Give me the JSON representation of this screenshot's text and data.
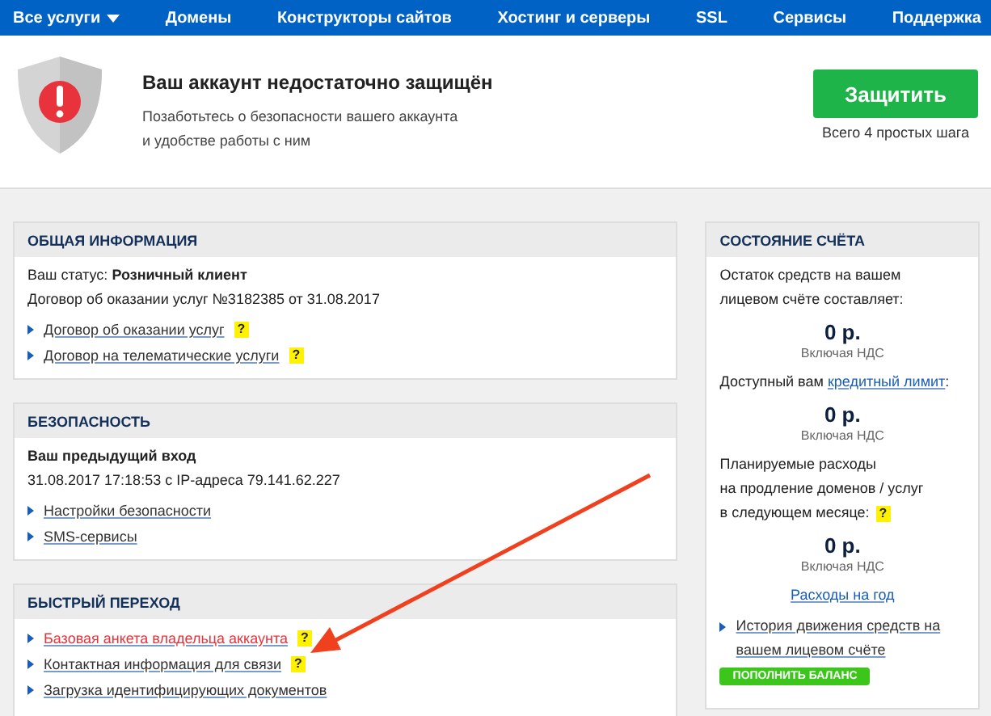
{
  "nav": {
    "items": [
      {
        "label": "Все услуги",
        "dropdown": true
      },
      {
        "label": "Домены",
        "dropdown": false
      },
      {
        "label": "Конструкторы сайтов",
        "dropdown": false
      },
      {
        "label": "Хостинг и серверы",
        "dropdown": false
      },
      {
        "label": "SSL",
        "dropdown": false
      },
      {
        "label": "Сервисы",
        "dropdown": false
      },
      {
        "label": "Поддержка",
        "dropdown": false
      }
    ]
  },
  "alert": {
    "title": "Ваш аккаунт недостаточно защищён",
    "text": "Позаботьтесь о безопасности вашего аккаунта",
    "text_2": "и удобстве работы с ним",
    "button": "Защитить",
    "button_note": "Всего 4 простых шага"
  },
  "general": {
    "title": "ОБЩАЯ ИНФОРМАЦИЯ",
    "status_label": "Ваш статус:",
    "status_value": "Розничный клиент",
    "contract": "Договор об оказании услуг №3182385 от 31.08.2017",
    "links": [
      {
        "label": "Договор об оказании услуг",
        "help": "?",
        "highlighted": false
      },
      {
        "label": "Договор на телематические услуги",
        "help": "?",
        "highlighted": false
      }
    ]
  },
  "security": {
    "title": "БЕЗОПАСНОСТЬ",
    "last_login_label": "Ваш предыдущий вход",
    "last_login": "31.08.2017 17:18:53 с IP-адреса 79.141.62.227",
    "links": [
      {
        "label": "Настройки безопасности",
        "highlighted": false
      },
      {
        "label": "SMS-сервисы",
        "highlighted": false
      }
    ]
  },
  "quick": {
    "title": "БЫСТРЫЙ ПЕРЕХОД",
    "links": [
      {
        "label": "Базовая анкета владельца аккаунта",
        "help": "?",
        "highlighted": true
      },
      {
        "label": "Контактная информация для связи",
        "help": "?",
        "highlighted": false
      },
      {
        "label": "Загрузка идентифицирующих документов",
        "highlighted": false
      }
    ]
  },
  "account": {
    "title": "СОСТОЯНИЕ СЧЁТА",
    "balance_text": [
      "Остаток средств на вашем",
      "лицевом счёте составляет:"
    ],
    "balance": "0 р.",
    "balance_note": "Включая НДС",
    "credit_text": "Доступный вам",
    "credit_link": "кредитный лимит",
    "credit_colon": ":",
    "credit": "0 р.",
    "credit_note": "Включая НДС",
    "planned_text": [
      "Планируемые расходы",
      "на продление доменов / услуг",
      "в следующем месяце:"
    ],
    "planned_help": "?",
    "planned": "0 р.",
    "planned_note": "Включая НДС",
    "year_link": "Расходы на год",
    "history_link": "История движения средств на вашем лицевом счёте",
    "topup_button": "ПОПОЛНИТЬ БАЛАНС"
  }
}
